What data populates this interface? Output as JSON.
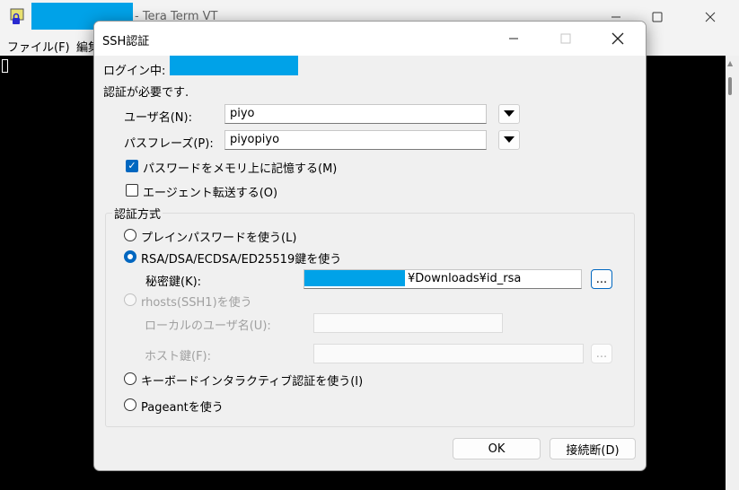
{
  "terminal": {
    "title": "- Tera Term VT",
    "menu": [
      "ファイル(F)",
      "編集"
    ]
  },
  "dialog": {
    "title": "SSH認証",
    "login_label": "ログイン中:",
    "auth_required": "認証が必要です.",
    "username_label": "ユーザ名(N):",
    "username_value": "piyo",
    "passphrase_label": "パスフレーズ(P):",
    "passphrase_value": "piyopiyo",
    "remember_password": {
      "label": "パスワードをメモリ上に記憶する(M)",
      "checked": true
    },
    "agent_forwarding": {
      "label": "エージェント転送する(O)",
      "checked": false
    },
    "auth_method_group": "認証方式",
    "options": {
      "plain": {
        "label": "プレインパスワードを使う(L)",
        "selected": false
      },
      "rsa": {
        "label": "RSA/DSA/ECDSA/ED25519鍵を使う",
        "selected": true
      },
      "rhosts": {
        "label": "rhosts(SSH1)を使う",
        "selected": false,
        "enabled": false
      },
      "keyboard": {
        "label": "キーボードインタラクティブ認証を使う(I)",
        "selected": false
      },
      "pageant": {
        "label": "Pageantを使う",
        "selected": false
      }
    },
    "private_key_label": "秘密鍵(K):",
    "private_key_value": "¥Downloads¥id_rsa",
    "browse_label": "...",
    "local_user_label": "ローカルのユーザ名(U):",
    "host_key_label": "ホスト鍵(F):",
    "host_browse_label": "...",
    "ok_label": "OK",
    "disconnect_label": "接続断(D)"
  },
  "colors": {
    "accent": "#0067c0",
    "redaction": "#00a2e8"
  }
}
